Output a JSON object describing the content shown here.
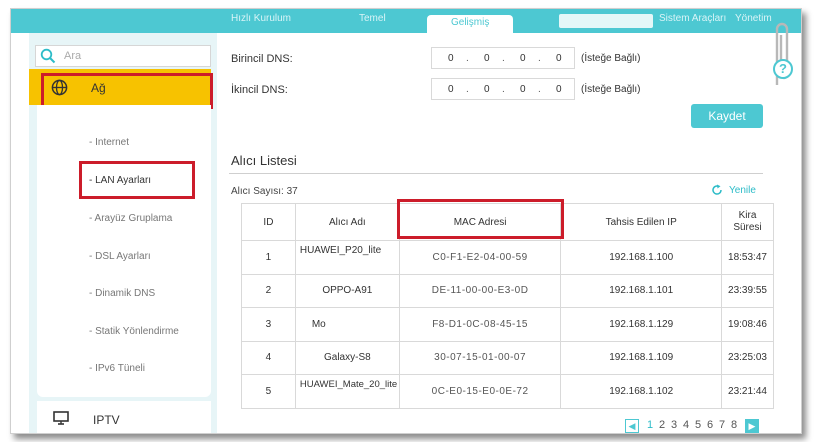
{
  "topbar": {
    "tabs": [
      "Hızlı Kurulum",
      "Temel",
      "Gelişmiş",
      "Sistem Araçları",
      "Yönetim"
    ],
    "active_tab": "Gelişmiş"
  },
  "sidebar": {
    "search_placeholder": "Ara",
    "ag_label": "Ağ",
    "submenu": [
      "- Internet",
      "- LAN Ayarları",
      "- Arayüz Gruplama",
      "- DSL Ayarları",
      "- Dinamik DNS",
      "- Statik Yönlendirme",
      "- IPv6 Tüneli"
    ],
    "iptv_label": "IPTV"
  },
  "dns": {
    "primary_label": "Birincil DNS:",
    "secondary_label": "İkincil DNS:",
    "primary_octets": [
      "0",
      "0",
      "0",
      "0"
    ],
    "secondary_octets": [
      "0",
      "0",
      "0",
      "0"
    ],
    "optional": "(İsteğe Bağlı)"
  },
  "save_label": "Kaydet",
  "client_list": {
    "title": "Alıcı Listesi",
    "count_label": "Alıcı Sayısı: 37",
    "refresh_label": "Yenile",
    "headers": [
      "ID",
      "Alıcı Adı",
      "MAC Adresi",
      "Tahsis Edilen IP",
      "Kira Süresi"
    ],
    "rows": [
      {
        "id": "1",
        "name": "HUAWEI_P20_lite",
        "mac": "C0-F1-E2-04-00-59",
        "ip": "192.168.1.100",
        "lease": "18:53:47"
      },
      {
        "id": "2",
        "name": "OPPO-A91",
        "mac": "DE-11-00-00-E3-0D",
        "ip": "192.168.1.101",
        "lease": "23:39:55"
      },
      {
        "id": "3",
        "name": "Mo",
        "mac": "F8-D1-0C-08-45-15",
        "ip": "192.168.1.129",
        "lease": "19:08:46"
      },
      {
        "id": "4",
        "name": "Galaxy-S8",
        "mac": "30-07-15-01-00-07",
        "ip": "192.168.1.109",
        "lease": "23:25:03"
      },
      {
        "id": "5",
        "name": "HUAWEI_Mate_20_lite",
        "mac": "0C-E0-15-E0-0E-72",
        "ip": "192.168.1.102",
        "lease": "23:21:44"
      }
    ]
  },
  "pagination": {
    "pages": [
      "1",
      "2",
      "3",
      "4",
      "5",
      "6",
      "7",
      "8"
    ],
    "current": "1"
  },
  "colors": {
    "accent": "#4dc8d2",
    "highlight": "#f7c200",
    "annotation_red": "#cc1c2a"
  }
}
